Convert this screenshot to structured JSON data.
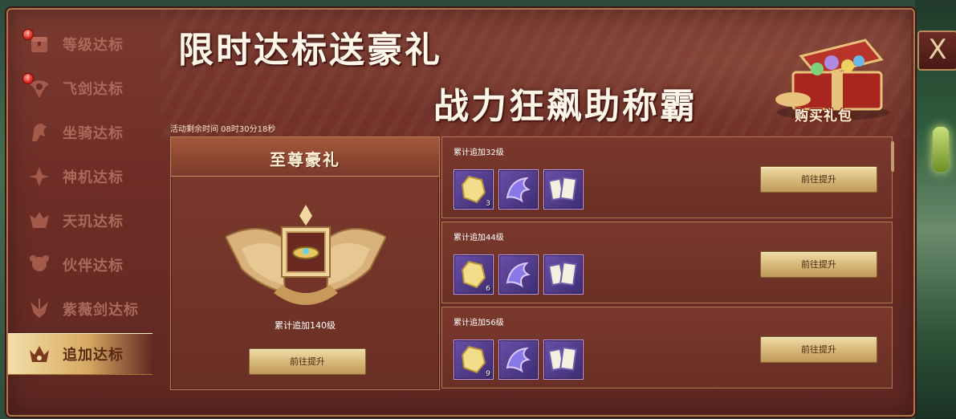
{
  "close_label": "X",
  "sidebar": {
    "items": [
      {
        "label": "等级达标",
        "icon": "treasure-chest-icon",
        "alert": true,
        "active": false
      },
      {
        "label": "飞剑达标",
        "icon": "flying-sword-icon",
        "alert": true,
        "active": false
      },
      {
        "label": "坐骑达标",
        "icon": "mount-icon",
        "alert": false,
        "active": false
      },
      {
        "label": "神机达标",
        "icon": "divine-machine-icon",
        "alert": false,
        "active": false
      },
      {
        "label": "天玑达标",
        "icon": "tianji-icon",
        "alert": false,
        "active": false
      },
      {
        "label": "伙伴达标",
        "icon": "partner-icon",
        "alert": false,
        "active": false
      },
      {
        "label": "紫薇剑达标",
        "icon": "ziwei-sword-icon",
        "alert": false,
        "active": false
      },
      {
        "label": "追加达标",
        "icon": "crown-icon",
        "alert": false,
        "active": true
      }
    ],
    "alert_mark": "!"
  },
  "banner": {
    "line1": "限时达标送豪礼",
    "line2": "战力狂飙助称霸",
    "gift_label": "购买礼包"
  },
  "timer": "活动剩余时间 08时30分18秒",
  "main_reward": {
    "title": "至尊豪礼",
    "desc": "累计追加140级",
    "button": "前往提升"
  },
  "rewards": [
    {
      "title": "累计追加32级",
      "items": [
        {
          "icon": "gold-crystal-icon",
          "count": "3"
        },
        {
          "icon": "purple-dragon-icon",
          "count": ""
        },
        {
          "icon": "skill-book-icon",
          "count": ""
        }
      ],
      "button": "前往提升"
    },
    {
      "title": "累计追加44级",
      "items": [
        {
          "icon": "gold-crystal-icon",
          "count": "6"
        },
        {
          "icon": "purple-dragon-icon",
          "count": ""
        },
        {
          "icon": "skill-book-icon",
          "count": ""
        }
      ],
      "button": "前往提升"
    },
    {
      "title": "累计追加56级",
      "items": [
        {
          "icon": "gold-crystal-icon",
          "count": "9"
        },
        {
          "icon": "purple-dragon-icon",
          "count": ""
        },
        {
          "icon": "skill-book-icon",
          "count": ""
        }
      ],
      "button": "前往提升"
    }
  ],
  "colors": {
    "panel": "#6d2d26",
    "border": "#b0784c",
    "gold_button": "#d8b97a",
    "active_tab": "#f4dfa8"
  }
}
